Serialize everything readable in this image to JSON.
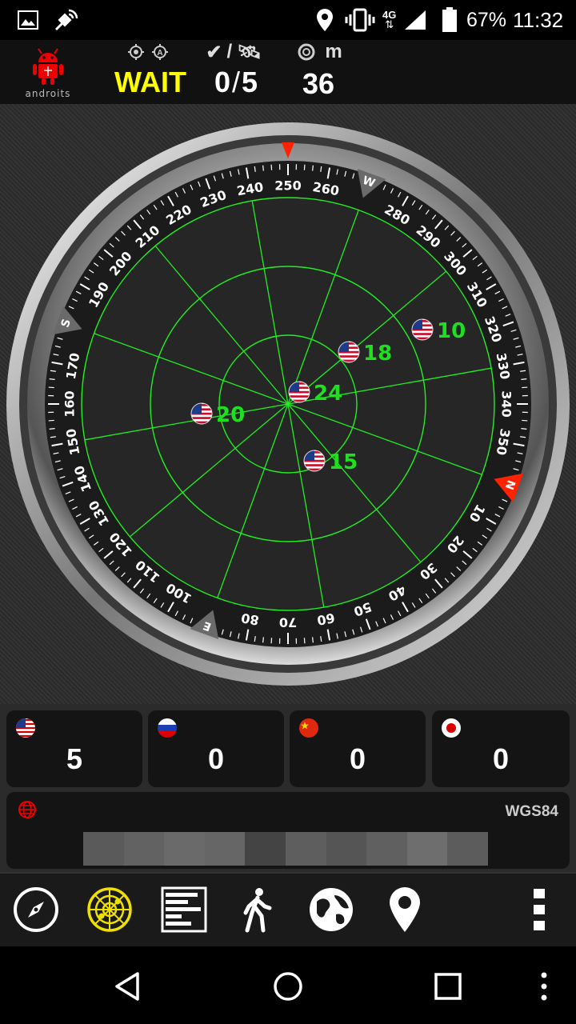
{
  "status_bar": {
    "battery": "67%",
    "time": "11:32",
    "network": "4G"
  },
  "header": {
    "app_name": "androits",
    "fix_status": "WAIT",
    "satellites_used": "0",
    "satellites_slash": "/",
    "satellites_visible": "5",
    "accuracy": "36",
    "accuracy_unit": "m",
    "header_slash": "/"
  },
  "compass": {
    "heading_ring_labels": [
      "10",
      "20",
      "30",
      "40",
      "50",
      "60",
      "70",
      "80",
      "100",
      "110",
      "120",
      "130",
      "140",
      "150",
      "160",
      "170",
      "190",
      "200",
      "210",
      "220",
      "230",
      "240",
      "250",
      "260",
      "280",
      "290",
      "300",
      "310",
      "320",
      "330",
      "340",
      "350"
    ],
    "cardinals": [
      "N",
      "E",
      "S",
      "W"
    ],
    "accent_color": "#ff2200",
    "grid_color": "#22ee22"
  },
  "satellites": [
    {
      "id": "10",
      "constellation": "GPS"
    },
    {
      "id": "18",
      "constellation": "GPS"
    },
    {
      "id": "24",
      "constellation": "GPS"
    },
    {
      "id": "20",
      "constellation": "GPS"
    },
    {
      "id": "15",
      "constellation": "GPS"
    }
  ],
  "constellation_counts": [
    {
      "name": "GPS",
      "count": "5",
      "flag": "usa-flag-icon"
    },
    {
      "name": "GLONASS",
      "count": "0",
      "flag": "russia-flag-icon"
    },
    {
      "name": "BEIDOU",
      "count": "0",
      "flag": "china-flag-icon"
    },
    {
      "name": "QZSS",
      "count": "0",
      "flag": "japan-flag-icon"
    }
  ],
  "coordinates": {
    "datum": "WGS84",
    "icon": "globe-grid-icon"
  },
  "toolbar": {
    "items": [
      "compass-icon",
      "radar-icon",
      "signal-bars-icon",
      "walking-person-icon",
      "globe-icon",
      "map-pin-icon",
      "overflow-menu-icon"
    ]
  },
  "navbar": {
    "items": [
      "back-icon",
      "home-icon",
      "recents-icon",
      "more-icon"
    ]
  }
}
